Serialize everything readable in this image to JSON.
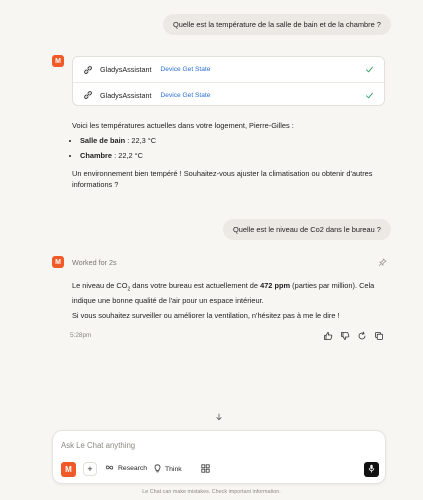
{
  "messages": {
    "user_1": "Quelle est la température de la salle de bain et de la chambre ?",
    "tool_calls": [
      {
        "name": "GladysAssistant",
        "action": "Device Get State"
      },
      {
        "name": "GladysAssistant",
        "action": "Device Get State"
      }
    ],
    "assistant_1": {
      "intro": "Voici les températures actuelles dans votre logement, Pierre-Gilles :",
      "bullets": [
        {
          "label": "Salle de bain",
          "value": " : 22,3 °C"
        },
        {
          "label": "Chambre",
          "value": " : 22,2 °C"
        }
      ],
      "outro": "Un environnement bien tempéré ! Souhaitez-vous ajuster la climatisation ou obtenir d'autres informations ?"
    },
    "user_2": "Quelle est le niveau de Co2 dans le bureau ?",
    "assistant_2": {
      "worked_for": "Worked for 2s",
      "p1_a": "Le niveau de CO",
      "p1_sub": "2",
      "p1_b": " dans votre bureau est actuellement de ",
      "p1_strong": "472 ppm",
      "p1_c": " (parties par million). Cela indique une bonne qualité de l'air pour un espace intérieur.",
      "p2": "Si vous souhaitez surveiller ou améliorer la ventilation, n'hésitez pas à me le dire !",
      "time": "5:28pm"
    }
  },
  "composer": {
    "placeholder": "Ask Le Chat anything",
    "research_label": "Research",
    "think_label": "Think"
  },
  "disclaimer": "Le Chat can make mistakes. Check important information.",
  "colors": {
    "brand": "#f05a28",
    "link": "#2b6fd6",
    "check": "#3aa66a"
  }
}
